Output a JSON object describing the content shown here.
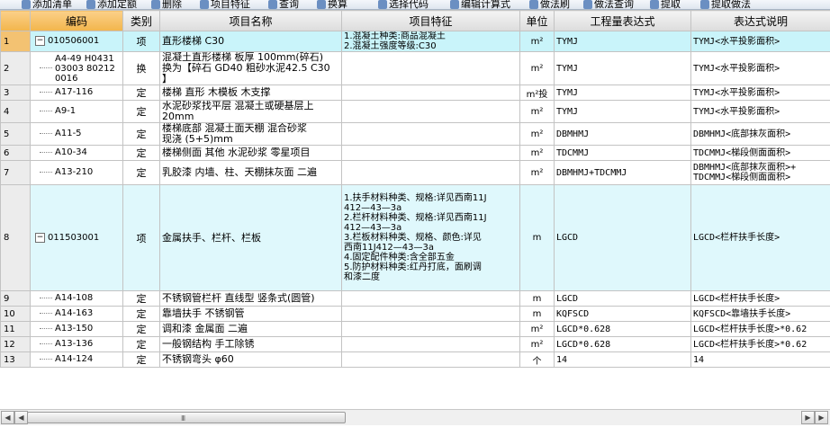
{
  "toolbar": {
    "items": [
      "添加清单",
      "添加定额",
      "删除",
      "项目特征",
      "查询",
      "换算",
      "选择代码",
      "编辑计算式",
      "做法刷",
      "做法查询",
      "提取",
      "提取做法"
    ]
  },
  "columns": [
    "编码",
    "类别",
    "项目名称",
    "项目特征",
    "单位",
    "工程量表达式",
    "表达式说明"
  ],
  "rows": [
    {
      "num": "1",
      "code": "010506001",
      "type": "项",
      "name": "直形楼梯 C30",
      "feature": "1.混凝土种类:商品混凝土\n2.混凝土强度等级:C30",
      "unit": "m²",
      "expr": "TYMJ",
      "desc": "TYMJ<水平投影面积>",
      "level": 0
    },
    {
      "num": "2",
      "code": "A4-49 H0431\n03003 80212\n0016",
      "type": "换",
      "name": "混凝土直形楼梯 板厚 100mm(碎石)\n换为【碎石 GD40 粗砂水泥42.5 C30\n】",
      "feature": "",
      "unit": "m²",
      "expr": "TYMJ",
      "desc": "TYMJ<水平投影面积>",
      "level": 1
    },
    {
      "num": "3",
      "code": "A17-116",
      "type": "定",
      "name": "楼梯 直形 木模板 木支撑",
      "feature": "",
      "unit": "m²投",
      "expr": "TYMJ",
      "desc": "TYMJ<水平投影面积>",
      "level": 1
    },
    {
      "num": "4",
      "code": "A9-1",
      "type": "定",
      "name": "水泥砂浆找平层 混凝土或硬基层上\n20mm",
      "feature": "",
      "unit": "m²",
      "expr": "TYMJ",
      "desc": "TYMJ<水平投影面积>",
      "level": 1
    },
    {
      "num": "5",
      "code": "A11-5",
      "type": "定",
      "name": "楼梯底部  混凝土面天棚 混合砂浆\n现浇 (5+5)mm",
      "feature": "",
      "unit": "m²",
      "expr": "DBMHMJ",
      "desc": "DBMHMJ<底部抹灰面积>",
      "level": 1
    },
    {
      "num": "6",
      "code": "A10-34",
      "type": "定",
      "name": "楼梯侧面  其他 水泥砂浆 零星项目",
      "feature": "",
      "unit": "m²",
      "expr": "TDCMMJ",
      "desc": "TDCMMJ<梯段侧面面积>",
      "level": 1
    },
    {
      "num": "7",
      "code": "A13-210",
      "type": "定",
      "name": "乳胶漆 内墙、柱、天棚抹灰面 二遍",
      "feature": "",
      "unit": "m²",
      "expr": "DBMHMJ+TDCMMJ",
      "desc": "DBMHMJ<底部抹灰面积>+\nTDCMMJ<梯段侧面面积>",
      "level": 1
    },
    {
      "num": "8",
      "code": "011503001",
      "type": "项",
      "name": "金属扶手、栏杆、栏板",
      "feature": "1.扶手材料种类、规格:详见西南11J\n412—43—3a\n2.栏杆材料种类、规格:详见西南11J\n412—43—3a\n3.栏板材料种类、规格、颜色:详见\n西南11J412—43—3a\n4.固定配件种类:含全部五金\n5.防护材料种类:红丹打底，面刷调\n和漆二度",
      "unit": "m",
      "expr": "LGCD",
      "desc": "LGCD<栏杆扶手长度>",
      "level": 0
    },
    {
      "num": "9",
      "code": "A14-108",
      "type": "定",
      "name": "不锈钢管栏杆 直线型 竖条式(圆管)",
      "feature": "",
      "unit": "m",
      "expr": "LGCD",
      "desc": "LGCD<栏杆扶手长度>",
      "level": 1
    },
    {
      "num": "10",
      "code": "A14-163",
      "type": "定",
      "name": "靠墙扶手 不锈钢管",
      "feature": "",
      "unit": "m",
      "expr": "KQFSCD",
      "desc": "KQFSCD<靠墙扶手长度>",
      "level": 1
    },
    {
      "num": "11",
      "code": "A13-150",
      "type": "定",
      "name": "调和漆 金属面 二遍",
      "feature": "",
      "unit": "m²",
      "expr": "LGCD*0.628",
      "desc": "LGCD<栏杆扶手长度>*0.62",
      "level": 1
    },
    {
      "num": "12",
      "code": "A13-136",
      "type": "定",
      "name": "一般钢结构 手工除锈",
      "feature": "",
      "unit": "m²",
      "expr": "LGCD*0.628",
      "desc": "LGCD<栏杆扶手长度>*0.62",
      "level": 1
    },
    {
      "num": "13",
      "code": "A14-124",
      "type": "定",
      "name": "不锈钢弯头 φ60",
      "feature": "",
      "unit": "个",
      "expr": "14",
      "desc": "14",
      "level": 1
    }
  ],
  "scrollbar": {
    "grip": "III"
  }
}
